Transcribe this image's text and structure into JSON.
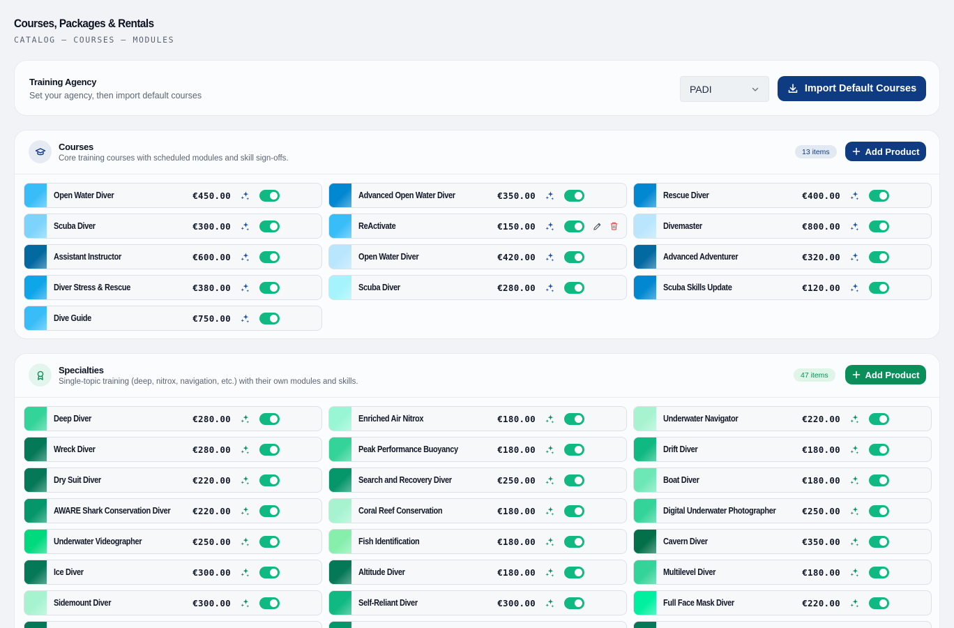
{
  "page": {
    "title": "Courses, Packages & Rentals",
    "breadcrumb": "CATALOG — COURSES — MODULES"
  },
  "agency": {
    "title": "Training Agency",
    "subtitle": "Set your agency, then import default courses",
    "selected": "PADI",
    "import_label": "Import Default Courses"
  },
  "courses": {
    "title": "Courses",
    "subtitle": "Core training courses with scheduled modules and skill sign-offs.",
    "count": "13 items",
    "add_label": "Add Product",
    "accent": "#0e3b82",
    "items": [
      {
        "name": "Open Water Diver",
        "price": "€450.00",
        "color": "#38bdf8"
      },
      {
        "name": "Advanced Open Water Diver",
        "price": "€350.00",
        "color": "#0288d1"
      },
      {
        "name": "Rescue Diver",
        "price": "€400.00",
        "color": "#0288d1"
      },
      {
        "name": "Scuba Diver",
        "price": "€300.00",
        "color": "#7dd3fc"
      },
      {
        "name": "ReActivate",
        "price": "€150.00",
        "color": "#38bdf8",
        "hovered": true
      },
      {
        "name": "Divemaster",
        "price": "€800.00",
        "color": "#bae6fd"
      },
      {
        "name": "Assistant Instructor",
        "price": "€600.00",
        "color": "#0369a1"
      },
      {
        "name": "Open Water Diver",
        "price": "€420.00",
        "color": "#bae6fd"
      },
      {
        "name": "Advanced Adventurer",
        "price": "€320.00",
        "color": "#0369a1"
      },
      {
        "name": "Diver Stress & Rescue",
        "price": "€380.00",
        "color": "#0ea5e9"
      },
      {
        "name": "Scuba Diver",
        "price": "€280.00",
        "color": "#a5f3fc"
      },
      {
        "name": "Scuba Skills Update",
        "price": "€120.00",
        "color": "#0288d1"
      },
      {
        "name": "Dive Guide",
        "price": "€750.00",
        "color": "#38bdf8"
      }
    ]
  },
  "specialties": {
    "title": "Specialties",
    "subtitle": "Single-topic training (deep, nitrox, navigation, etc.) with their own modules and skills.",
    "count": "47 items",
    "add_label": "Add Product",
    "accent": "#0a8f5b",
    "items": [
      {
        "name": "Deep Diver",
        "price": "€280.00",
        "color": "#34d399"
      },
      {
        "name": "Enriched Air Nitrox",
        "price": "€180.00",
        "color": "#99f6d4"
      },
      {
        "name": "Underwater Navigator",
        "price": "€220.00",
        "color": "#a7f3d0"
      },
      {
        "name": "Wreck Diver",
        "price": "€280.00",
        "color": "#047857"
      },
      {
        "name": "Peak Performance Buoyancy",
        "price": "€180.00",
        "color": "#34d399"
      },
      {
        "name": "Drift Diver",
        "price": "€180.00",
        "color": "#10b981"
      },
      {
        "name": "Dry Suit Diver",
        "price": "€220.00",
        "color": "#047857"
      },
      {
        "name": "Search and Recovery Diver",
        "price": "€250.00",
        "color": "#059669"
      },
      {
        "name": "Boat Diver",
        "price": "€180.00",
        "color": "#6ee7b7"
      },
      {
        "name": "AWARE Shark Conservation Diver",
        "price": "€220.00",
        "color": "#059669"
      },
      {
        "name": "Coral Reef Conservation",
        "price": "€180.00",
        "color": "#a7f3d0"
      },
      {
        "name": "Digital Underwater Photographer",
        "price": "€250.00",
        "color": "#34d399"
      },
      {
        "name": "Underwater Videographer",
        "price": "€250.00",
        "color": "#00d97e"
      },
      {
        "name": "Fish Identification",
        "price": "€180.00",
        "color": "#86efac"
      },
      {
        "name": "Cavern Diver",
        "price": "€350.00",
        "color": "#04704a"
      },
      {
        "name": "Ice Diver",
        "price": "€300.00",
        "color": "#047857"
      },
      {
        "name": "Altitude Diver",
        "price": "€180.00",
        "color": "#047857"
      },
      {
        "name": "Multilevel Diver",
        "price": "€180.00",
        "color": "#34d399"
      },
      {
        "name": "Sidemount Diver",
        "price": "€300.00",
        "color": "#a7f3d0"
      },
      {
        "name": "Self-Reliant Diver",
        "price": "€300.00",
        "color": "#10b981"
      },
      {
        "name": "Full Face Mask Diver",
        "price": "€220.00",
        "color": "#00f0a0"
      },
      {
        "name": "",
        "price": "",
        "color": "#047857"
      },
      {
        "name": "",
        "price": "",
        "color": "#059669"
      },
      {
        "name": "",
        "price": "",
        "color": "#047857"
      }
    ]
  }
}
